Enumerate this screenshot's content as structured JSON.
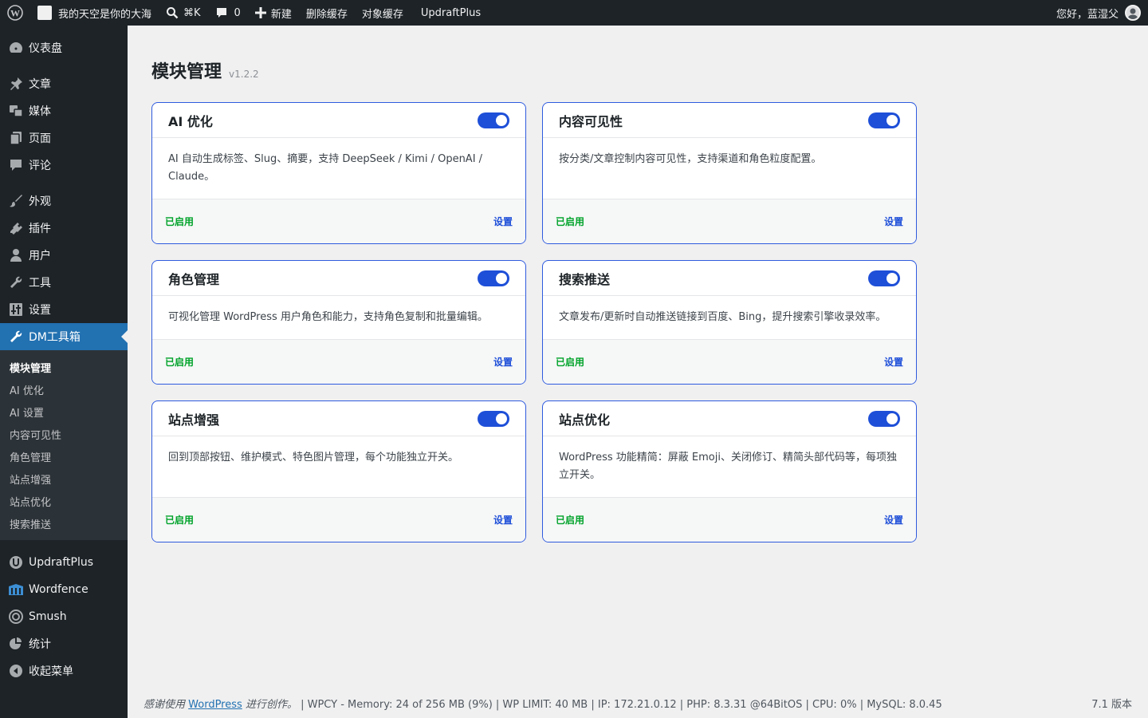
{
  "adminbar": {
    "site_name": "我的天空是你的大海",
    "shortcut": "⌘K",
    "comments_count": "0",
    "new_label": "新建",
    "clear_cache": "删除缓存",
    "object_cache": "对象缓存",
    "updraft": "UpdraftPlus",
    "greeting": "您好，蓝湿父"
  },
  "sidebar": {
    "dashboard": "仪表盘",
    "posts": "文章",
    "media": "媒体",
    "pages": "页面",
    "comments": "评论",
    "appearance": "外观",
    "plugins": "插件",
    "users": "用户",
    "tools": "工具",
    "settings": "设置",
    "dm_toolbox": "DM工具箱",
    "submenu": [
      "模块管理",
      "AI 优化",
      "AI 设置",
      "内容可见性",
      "角色管理",
      "站点增强",
      "站点优化",
      "搜索推送"
    ],
    "updraftplus": "UpdraftPlus",
    "wordfence": "Wordfence",
    "smush": "Smush",
    "stats": "统计",
    "collapse": "收起菜单"
  },
  "page": {
    "title": "模块管理",
    "version": "v1.2.2"
  },
  "modules": [
    {
      "title": "AI 优化",
      "desc": "AI 自动生成标签、Slug、摘要，支持 DeepSeek / Kimi / OpenAI / Claude。",
      "status": "已启用",
      "link": "设置",
      "enabled": true
    },
    {
      "title": "内容可见性",
      "desc": "按分类/文章控制内容可见性，支持渠道和角色粒度配置。",
      "status": "已启用",
      "link": "设置",
      "enabled": true
    },
    {
      "title": "角色管理",
      "desc": "可视化管理 WordPress 用户角色和能力，支持角色复制和批量编辑。",
      "status": "已启用",
      "link": "设置",
      "enabled": true
    },
    {
      "title": "搜索推送",
      "desc": "文章发布/更新时自动推送链接到百度、Bing，提升搜索引擎收录效率。",
      "status": "已启用",
      "link": "设置",
      "enabled": true
    },
    {
      "title": "站点增强",
      "desc": "回到顶部按钮、维护模式、特色图片管理，每个功能独立开关。",
      "status": "已启用",
      "link": "设置",
      "enabled": true
    },
    {
      "title": "站点优化",
      "desc": "WordPress 功能精简：屏蔽 Emoji、关闭修订、精简头部代码等，每项独立开关。",
      "status": "已启用",
      "link": "设置",
      "enabled": true
    }
  ],
  "footer": {
    "thanks_prefix": "感谢使用",
    "wordpress_link": "WordPress",
    "thanks_suffix": "进行创作。",
    "info": " | WPCY - Memory: 24 of 256 MB (9%) | WP LIMIT: 40 MB | IP: 172.21.0.12 | PHP: 8.3.31 @64BitOS | CPU: 0% | MySQL: 8.0.45",
    "version": "7.1 版本"
  },
  "colors": {
    "accent": "#1e4fd8",
    "active_menu": "#2271b1",
    "enabled": "#00a32a"
  }
}
